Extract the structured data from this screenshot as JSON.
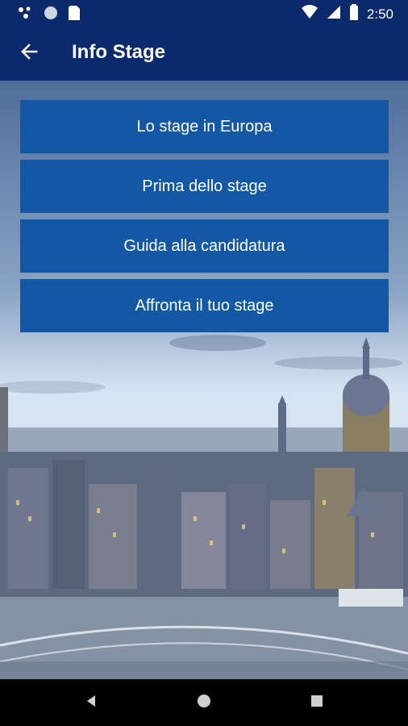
{
  "status_bar": {
    "time": "2:50",
    "icons": [
      "network-icon",
      "circle-icon",
      "sim-card-icon",
      "wifi-icon",
      "signal-icon",
      "battery-icon"
    ]
  },
  "app_bar": {
    "title": "Info Stage",
    "back_icon": "arrow-left-icon"
  },
  "menu": {
    "items": [
      {
        "label": "Lo stage in Europa"
      },
      {
        "label": "Prima dello stage"
      },
      {
        "label": "Guida alla candidatura"
      },
      {
        "label": "Affronta il tuo stage"
      }
    ]
  },
  "nav_bar": {
    "icons": [
      "back-triangle-icon",
      "home-circle-icon",
      "recents-square-icon"
    ]
  },
  "colors": {
    "primary_dark": "#0a2a6b",
    "button": "#1358a4"
  }
}
